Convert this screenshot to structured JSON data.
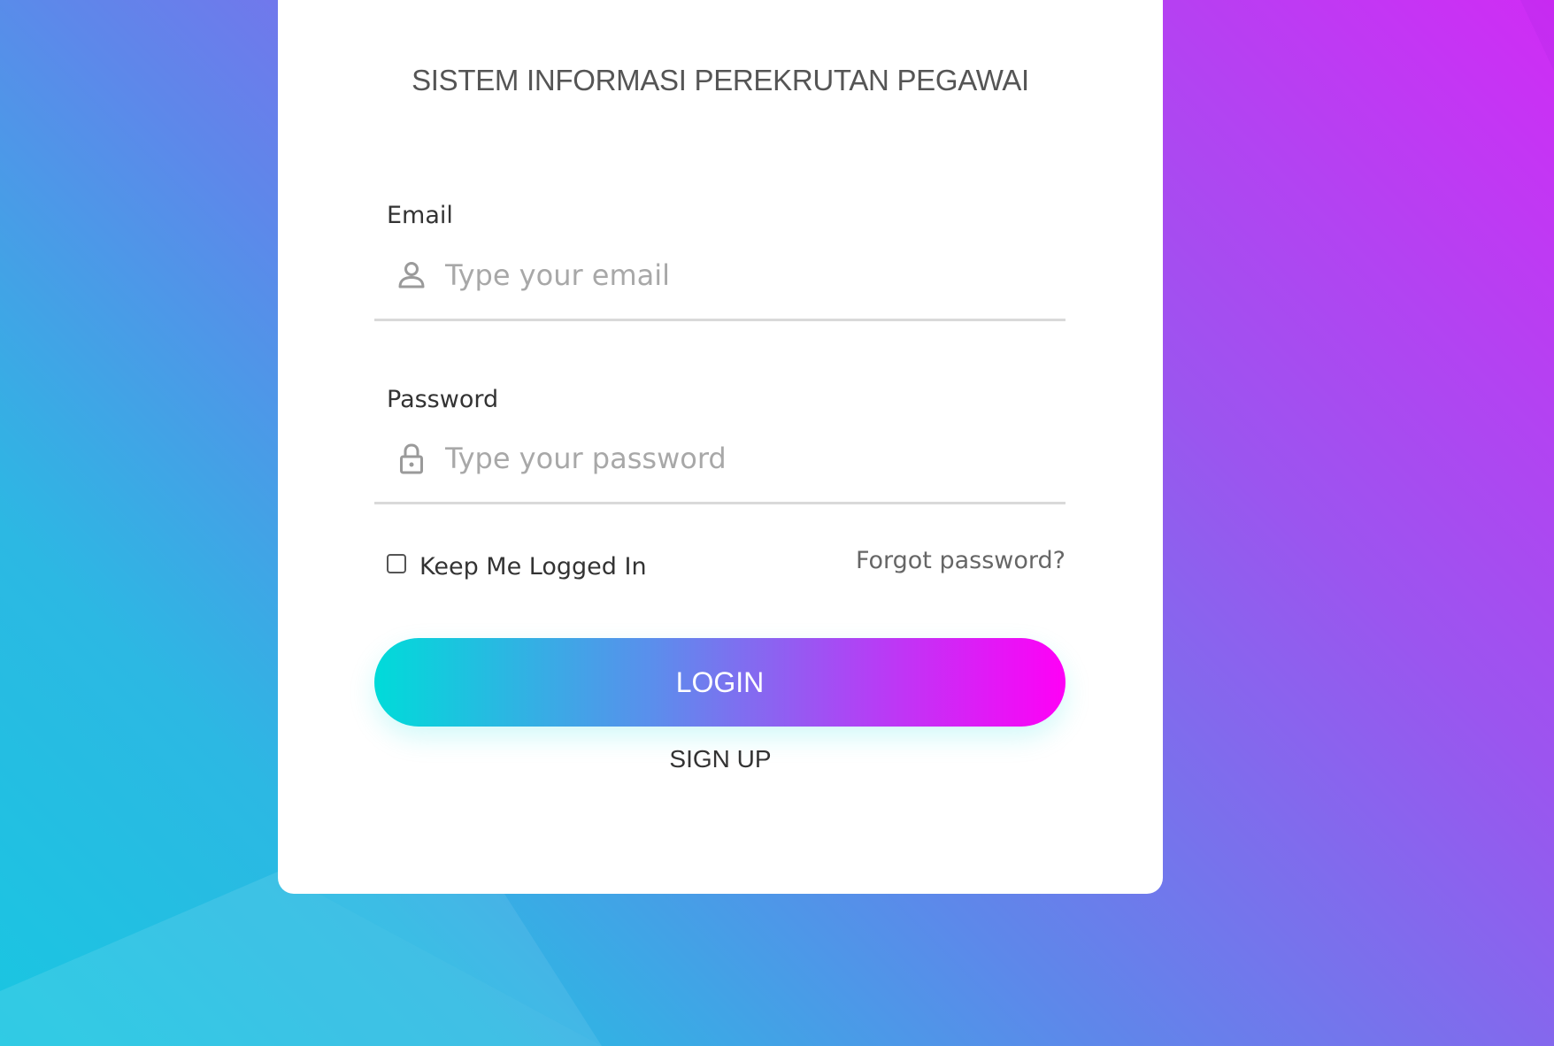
{
  "login": {
    "title": "SISTEM INFORMASI PEREKRUTAN PEGAWAI",
    "email": {
      "label": "Email",
      "placeholder": "Type your email",
      "value": "",
      "icon": "user-icon"
    },
    "password": {
      "label": "Password",
      "placeholder": "Type your password",
      "value": "",
      "icon": "lock-icon"
    },
    "remember": {
      "label": "Keep Me Logged In",
      "checked": false
    },
    "forgot_label": "Forgot password?",
    "login_label": "LOGIN",
    "signup_label": "SIGN UP"
  },
  "colors": {
    "button_gradient_start": "#00dbd9",
    "button_gradient_end": "#ff00f6",
    "background_top_right": "#d02cf5",
    "background_bottom_left": "#19c6e1",
    "card": "#ffffff"
  }
}
